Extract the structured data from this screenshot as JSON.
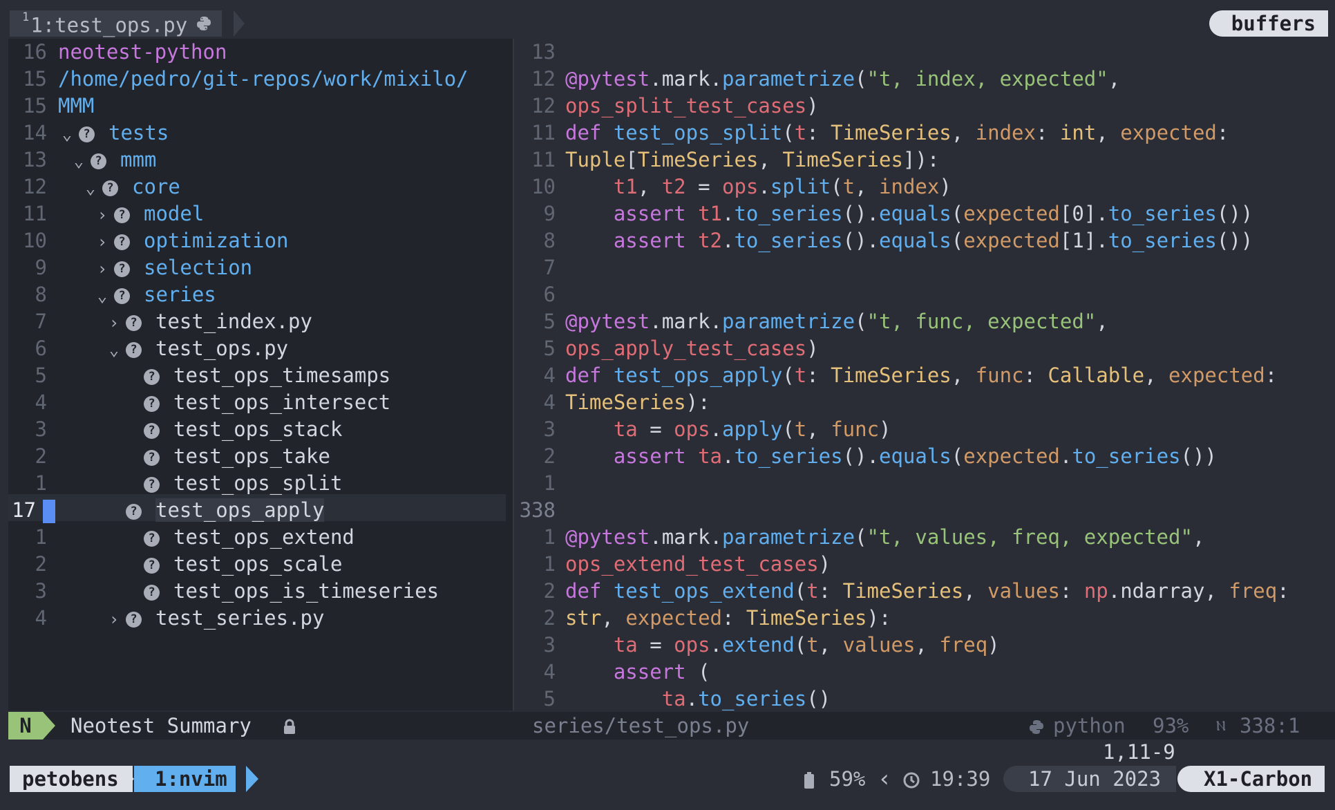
{
  "tabline": {
    "tab_index": "1",
    "tab_label": "1:test_ops.py",
    "buffers_label": "buffers"
  },
  "tree": {
    "lines": [
      {
        "num": "16",
        "text": "neotest-python",
        "kind": "header"
      },
      {
        "num": "15",
        "text": "/home/pedro/git-repos/work/mixilo/",
        "kind": "path"
      },
      {
        "num": "15",
        "text": "MMM",
        "kind": "path"
      },
      {
        "num": "14",
        "text": "tests",
        "kind": "dir-open",
        "indent": 0
      },
      {
        "num": "13",
        "text": "mmm",
        "kind": "dir-open",
        "indent": 1
      },
      {
        "num": "12",
        "text": "core",
        "kind": "dir-open",
        "indent": 2
      },
      {
        "num": "11",
        "text": "model",
        "kind": "dir-closed",
        "indent": 3
      },
      {
        "num": "10",
        "text": "optimization",
        "kind": "dir-closed",
        "indent": 3
      },
      {
        "num": "9",
        "text": "selection",
        "kind": "dir-closed",
        "indent": 3
      },
      {
        "num": "8",
        "text": "series",
        "kind": "dir-open",
        "indent": 3
      },
      {
        "num": "7",
        "text": "test_index.py",
        "kind": "file-closed",
        "indent": 4
      },
      {
        "num": "6",
        "text": "test_ops.py",
        "kind": "file-open",
        "indent": 4
      },
      {
        "num": "5",
        "text": "test_ops_timesamps",
        "kind": "test"
      },
      {
        "num": "4",
        "text": "test_ops_intersect",
        "kind": "test"
      },
      {
        "num": "3",
        "text": "test_ops_stack",
        "kind": "test"
      },
      {
        "num": "2",
        "text": "test_ops_take",
        "kind": "test"
      },
      {
        "num": "1",
        "text": "test_ops_split",
        "kind": "test"
      },
      {
        "num": "17",
        "text": "test_ops_apply",
        "kind": "test-current"
      },
      {
        "num": "1",
        "text": "test_ops_extend",
        "kind": "test"
      },
      {
        "num": "2",
        "text": "test_ops_scale",
        "kind": "test"
      },
      {
        "num": "3",
        "text": "test_ops_is_timeseries",
        "kind": "test"
      },
      {
        "num": "4",
        "text": "test_series.py",
        "kind": "file-closed",
        "indent": 4
      }
    ]
  },
  "code": {
    "lines": [
      {
        "num": "13",
        "tokens": []
      },
      {
        "num": "12",
        "tokens": [
          [
            "k",
            "@pytest"
          ],
          [
            "d",
            "."
          ],
          [
            "d",
            "mark"
          ],
          [
            "d",
            "."
          ],
          [
            "f",
            "parametrize"
          ],
          [
            "d",
            "("
          ],
          [
            "s",
            "\"t, index, expected\""
          ],
          [
            "d",
            ","
          ]
        ]
      },
      {
        "num": "12",
        "tokens": [
          [
            "v",
            "ops_split_test_cases"
          ],
          [
            "d",
            ")"
          ]
        ]
      },
      {
        "num": "11",
        "tokens": [
          [
            "k",
            "def "
          ],
          [
            "f",
            "test_ops_split"
          ],
          [
            "d",
            "("
          ],
          [
            "v",
            "t"
          ],
          [
            "d",
            ": "
          ],
          [
            "ty",
            "TimeSeries"
          ],
          [
            "d",
            ", "
          ],
          [
            "p",
            "index"
          ],
          [
            "d",
            ": "
          ],
          [
            "ty",
            "int"
          ],
          [
            "d",
            ", "
          ],
          [
            "p",
            "expected"
          ],
          [
            "d",
            ":"
          ]
        ]
      },
      {
        "num": "11",
        "tokens": [
          [
            "ty",
            "Tuple"
          ],
          [
            "d",
            "["
          ],
          [
            "ty",
            "TimeSeries"
          ],
          [
            "d",
            ", "
          ],
          [
            "ty",
            "TimeSeries"
          ],
          [
            "d",
            "]):"
          ]
        ]
      },
      {
        "num": "10",
        "tokens": [
          [
            "d",
            "    "
          ],
          [
            "v",
            "t1"
          ],
          [
            "d",
            ", "
          ],
          [
            "v",
            "t2"
          ],
          [
            "d",
            " = "
          ],
          [
            "v",
            "ops"
          ],
          [
            "d",
            "."
          ],
          [
            "f",
            "split"
          ],
          [
            "d",
            "("
          ],
          [
            "p",
            "t"
          ],
          [
            "d",
            ", "
          ],
          [
            "p",
            "index"
          ],
          [
            "d",
            ")"
          ]
        ]
      },
      {
        "num": "9",
        "tokens": [
          [
            "d",
            "    "
          ],
          [
            "k",
            "assert "
          ],
          [
            "v",
            "t1"
          ],
          [
            "d",
            "."
          ],
          [
            "f",
            "to_series"
          ],
          [
            "d",
            "()."
          ],
          [
            "f",
            "equals"
          ],
          [
            "d",
            "("
          ],
          [
            "p",
            "expected"
          ],
          [
            "d",
            "[0]."
          ],
          [
            "f",
            "to_series"
          ],
          [
            "d",
            "())"
          ]
        ]
      },
      {
        "num": "8",
        "tokens": [
          [
            "d",
            "    "
          ],
          [
            "k",
            "assert "
          ],
          [
            "v",
            "t2"
          ],
          [
            "d",
            "."
          ],
          [
            "f",
            "to_series"
          ],
          [
            "d",
            "()."
          ],
          [
            "f",
            "equals"
          ],
          [
            "d",
            "("
          ],
          [
            "p",
            "expected"
          ],
          [
            "d",
            "[1]."
          ],
          [
            "f",
            "to_series"
          ],
          [
            "d",
            "())"
          ]
        ]
      },
      {
        "num": "7",
        "tokens": []
      },
      {
        "num": "6",
        "tokens": []
      },
      {
        "num": "5",
        "tokens": [
          [
            "k",
            "@pytest"
          ],
          [
            "d",
            "."
          ],
          [
            "d",
            "mark"
          ],
          [
            "d",
            "."
          ],
          [
            "f",
            "parametrize"
          ],
          [
            "d",
            "("
          ],
          [
            "s",
            "\"t, func, expected\""
          ],
          [
            "d",
            ","
          ]
        ]
      },
      {
        "num": "5",
        "tokens": [
          [
            "v",
            "ops_apply_test_cases"
          ],
          [
            "d",
            ")"
          ]
        ]
      },
      {
        "num": "4",
        "tokens": [
          [
            "k",
            "def "
          ],
          [
            "f",
            "test_ops_apply"
          ],
          [
            "d",
            "("
          ],
          [
            "v",
            "t"
          ],
          [
            "d",
            ": "
          ],
          [
            "ty",
            "TimeSeries"
          ],
          [
            "d",
            ", "
          ],
          [
            "p",
            "func"
          ],
          [
            "d",
            ": "
          ],
          [
            "ty",
            "Callable"
          ],
          [
            "d",
            ", "
          ],
          [
            "p",
            "expected"
          ],
          [
            "d",
            ":"
          ]
        ]
      },
      {
        "num": "4",
        "tokens": [
          [
            "ty",
            "TimeSeries"
          ],
          [
            "d",
            "):"
          ]
        ]
      },
      {
        "num": "3",
        "tokens": [
          [
            "d",
            "    "
          ],
          [
            "v",
            "ta"
          ],
          [
            "d",
            " = "
          ],
          [
            "v",
            "ops"
          ],
          [
            "d",
            "."
          ],
          [
            "f",
            "apply"
          ],
          [
            "d",
            "("
          ],
          [
            "p",
            "t"
          ],
          [
            "d",
            ", "
          ],
          [
            "p",
            "func"
          ],
          [
            "d",
            ")"
          ]
        ]
      },
      {
        "num": "2",
        "tokens": [
          [
            "d",
            "    "
          ],
          [
            "k",
            "assert "
          ],
          [
            "v",
            "ta"
          ],
          [
            "d",
            "."
          ],
          [
            "f",
            "to_series"
          ],
          [
            "d",
            "()."
          ],
          [
            "f",
            "equals"
          ],
          [
            "d",
            "("
          ],
          [
            "p",
            "expected"
          ],
          [
            "d",
            "."
          ],
          [
            "f",
            "to_series"
          ],
          [
            "d",
            "())"
          ]
        ]
      },
      {
        "num": "1",
        "tokens": []
      },
      {
        "num": "338",
        "tokens": []
      },
      {
        "num": "1",
        "tokens": [
          [
            "k",
            "@pytest"
          ],
          [
            "d",
            "."
          ],
          [
            "d",
            "mark"
          ],
          [
            "d",
            "."
          ],
          [
            "f",
            "parametrize"
          ],
          [
            "d",
            "("
          ],
          [
            "s",
            "\"t, values, freq, expected\""
          ],
          [
            "d",
            ","
          ]
        ]
      },
      {
        "num": "1",
        "tokens": [
          [
            "v",
            "ops_extend_test_cases"
          ],
          [
            "d",
            ")"
          ]
        ]
      },
      {
        "num": "2",
        "tokens": [
          [
            "k",
            "def "
          ],
          [
            "f",
            "test_ops_extend"
          ],
          [
            "d",
            "("
          ],
          [
            "v",
            "t"
          ],
          [
            "d",
            ": "
          ],
          [
            "ty",
            "TimeSeries"
          ],
          [
            "d",
            ", "
          ],
          [
            "p",
            "values"
          ],
          [
            "d",
            ": "
          ],
          [
            "v",
            "np"
          ],
          [
            "d",
            "."
          ],
          [
            "d",
            "ndarray"
          ],
          [
            "d",
            ", "
          ],
          [
            "p",
            "freq"
          ],
          [
            "d",
            ":"
          ]
        ]
      },
      {
        "num": "2",
        "tokens": [
          [
            "ty",
            "str"
          ],
          [
            "d",
            ", "
          ],
          [
            "p",
            "expected"
          ],
          [
            "d",
            ": "
          ],
          [
            "ty",
            "TimeSeries"
          ],
          [
            "d",
            "):"
          ]
        ]
      },
      {
        "num": "3",
        "tokens": [
          [
            "d",
            "    "
          ],
          [
            "v",
            "ta"
          ],
          [
            "d",
            " = "
          ],
          [
            "v",
            "ops"
          ],
          [
            "d",
            "."
          ],
          [
            "f",
            "extend"
          ],
          [
            "d",
            "("
          ],
          [
            "p",
            "t"
          ],
          [
            "d",
            ", "
          ],
          [
            "p",
            "values"
          ],
          [
            "d",
            ", "
          ],
          [
            "p",
            "freq"
          ],
          [
            "d",
            ")"
          ]
        ]
      },
      {
        "num": "4",
        "tokens": [
          [
            "d",
            "    "
          ],
          [
            "k",
            "assert "
          ],
          [
            "d",
            "("
          ]
        ]
      },
      {
        "num": "5",
        "tokens": [
          [
            "d",
            "        "
          ],
          [
            "v",
            "ta"
          ],
          [
            "d",
            "."
          ],
          [
            "f",
            "to_series"
          ],
          [
            "d",
            "()"
          ]
        ]
      }
    ]
  },
  "statusline": {
    "mode": "N",
    "title": "Neotest Summary",
    "file": "series/test_ops.py",
    "filetype": "python",
    "percent": "93%",
    "position": "338:1"
  },
  "cmdline": {
    "text": "1,11-9"
  },
  "tmux": {
    "session": "petobens",
    "window": "1:nvim",
    "battery": "59%",
    "time": "19:39",
    "date": "17 Jun 2023",
    "host": "X1-Carbon"
  }
}
